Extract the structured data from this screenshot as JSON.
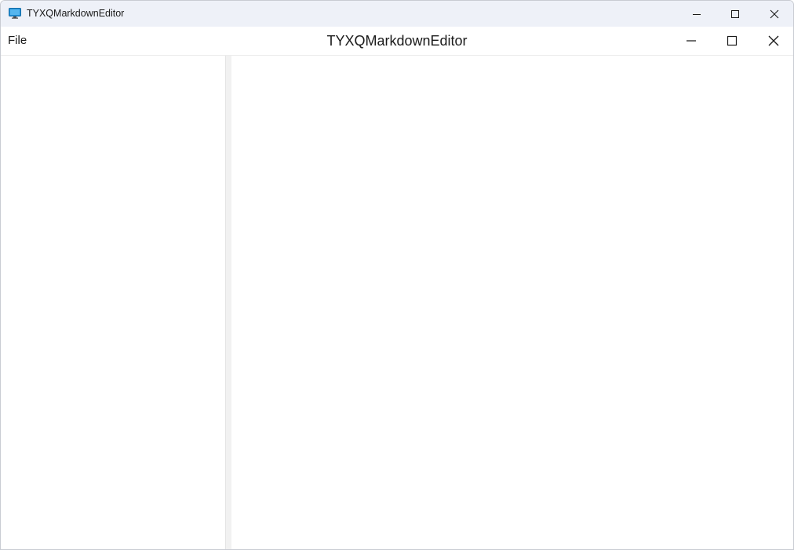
{
  "window": {
    "title": "TYXQMarkdownEditor",
    "icon": "monitor-app-icon"
  },
  "os_controls": {
    "minimize": "minimize-icon",
    "maximize": "maximize-icon",
    "close": "close-icon"
  },
  "app": {
    "menu": {
      "file_label": "File"
    },
    "title": "TYXQMarkdownEditor",
    "controls": {
      "minimize": "minimize-icon",
      "maximize": "maximize-icon",
      "close": "close-icon"
    }
  },
  "colors": {
    "titlebar_bg": "#eef1f8",
    "splitter_bg": "#f1f1f1",
    "icon_blue": "#1f8fd6"
  }
}
